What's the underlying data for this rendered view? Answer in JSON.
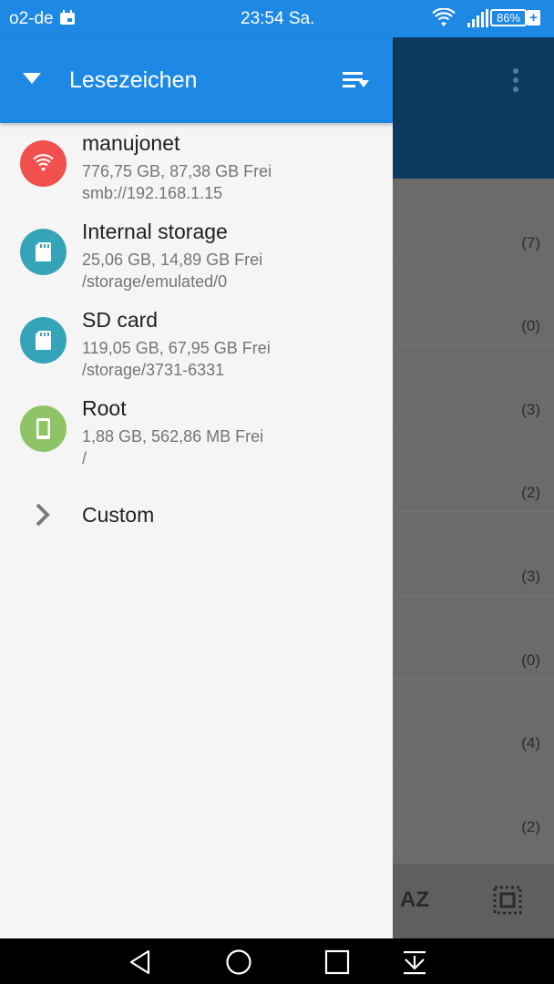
{
  "status_bar": {
    "carrier": "o2-de",
    "time": "23:54 Sa.",
    "battery": "86%",
    "icons": [
      "calendar-icon",
      "wifi-icon",
      "signal-icon",
      "battery-icon",
      "charging-icon"
    ]
  },
  "drawer": {
    "title": "Lesezeichen",
    "items": [
      {
        "name": "manujonet",
        "size": "776,75 GB,  87,38 GB Frei",
        "path": "smb://192.168.1.15",
        "icon": "wifi-icon",
        "color": "#f2504d"
      },
      {
        "name": "Internal storage",
        "size": "25,06 GB,  14,89 GB Frei",
        "path": "/storage/emulated/0",
        "icon": "sd-card-icon",
        "color": "#36a4b8"
      },
      {
        "name": "SD card",
        "size": "119,05 GB,  67,95 GB Frei",
        "path": "/storage/3731-6331",
        "icon": "sd-card-icon",
        "color": "#36a4b8"
      },
      {
        "name": "Root",
        "size": "1,88 GB,  562,86 MB Frei",
        "path": "/",
        "icon": "phone-icon",
        "color": "#8ec466"
      }
    ],
    "custom_label": "Custom"
  },
  "background": {
    "counts": [
      "(7)",
      "(0)",
      "(3)",
      "(2)",
      "(3)",
      "(0)",
      "(4)",
      "(2)"
    ],
    "sort_label": "AZ"
  },
  "colors": {
    "accent": "#1e88e5",
    "toolbar_dark": "#0d3a60"
  }
}
